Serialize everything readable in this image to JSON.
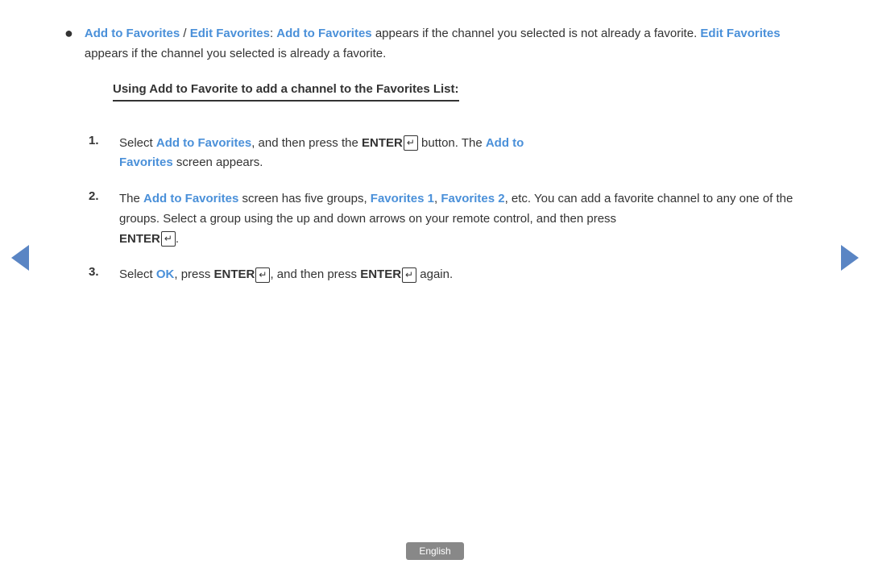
{
  "colors": {
    "link": "#4a90d9",
    "text": "#333333",
    "badge_bg": "#888888"
  },
  "content": {
    "bullet": {
      "term1": "Add to Favorites",
      "separator": " / ",
      "term2": "Edit Favorites",
      "colon": ": ",
      "term3": "Add to Favorites",
      "text1": " appears if the channel you selected is not already a favorite. ",
      "term4": "Edit Favorites",
      "text2": " appears if the channel you selected is already a favorite."
    },
    "subheading": "Using Add to Favorite to add a channel to the Favorites List:",
    "steps": [
      {
        "number": "1.",
        "pre1": "Select ",
        "link1": "Add to Favorites",
        "mid1": ", and then press the ",
        "enter1_text": "ENTER",
        "mid2": " button. The ",
        "link2": "Add to",
        "link3": "Favorites",
        "post1": " screen appears."
      },
      {
        "number": "2.",
        "pre1": "The ",
        "link1": "Add to Favorites",
        "mid1": " screen has five groups, ",
        "link2": "Favorites 1",
        "comma": ", ",
        "link3": "Favorites 2",
        "mid2": ", etc. You can add a favorite channel to any one of the groups. Select a group using the up and down arrows on your remote control, and then press",
        "enter_text": "ENTER",
        "post1": "."
      },
      {
        "number": "3.",
        "pre1": "Select ",
        "link1": "OK",
        "mid1": ", press ",
        "enter1": "ENTER",
        "mid2": ", and then press ",
        "enter2": "ENTER",
        "post1": " again."
      }
    ],
    "language_badge": "English"
  },
  "nav": {
    "left_arrow_label": "previous",
    "right_arrow_label": "next"
  }
}
